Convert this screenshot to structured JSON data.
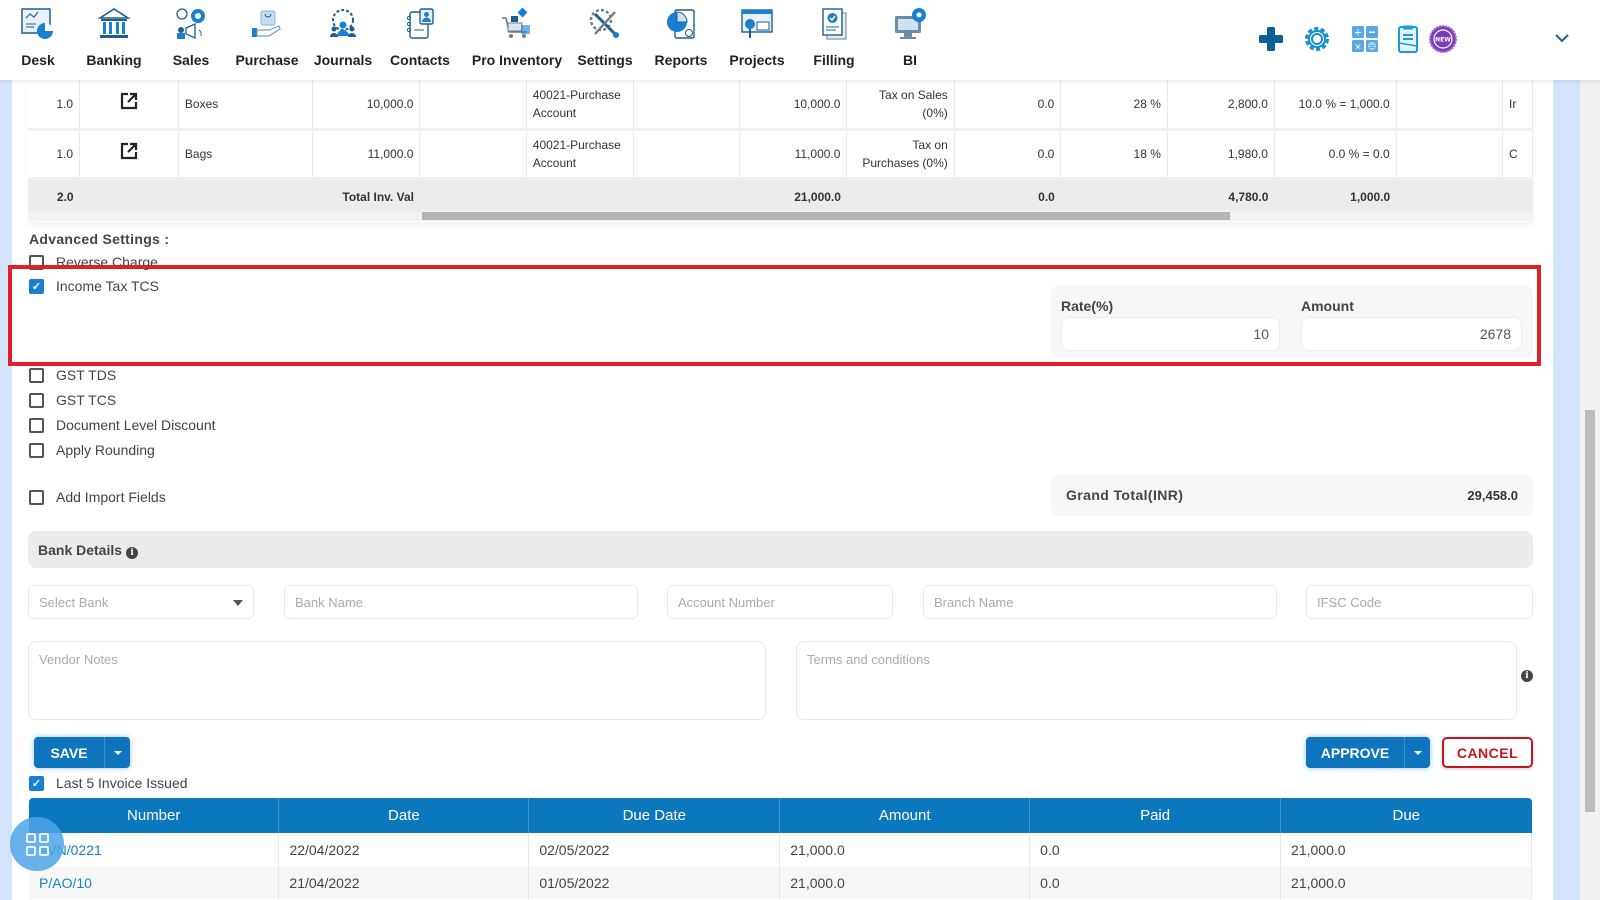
{
  "nav": {
    "items": [
      {
        "label": "Desk",
        "icon": "desk-dashboard-icon"
      },
      {
        "label": "Banking",
        "icon": "bank-building-icon"
      },
      {
        "label": "Sales",
        "icon": "sales-megaphone-icon"
      },
      {
        "label": "Purchase",
        "icon": "purchase-bag-hand-icon"
      },
      {
        "label": "Journals",
        "icon": "journals-team-gear-icon"
      },
      {
        "label": "Contacts",
        "icon": "contacts-book-icon"
      },
      {
        "label": "Pro Inventory",
        "icon": "inventory-cart-icon"
      },
      {
        "label": "Settings",
        "icon": "settings-tools-icon"
      },
      {
        "label": "Reports",
        "icon": "reports-pie-chart-icon"
      },
      {
        "label": "Projects",
        "icon": "projects-board-icon"
      },
      {
        "label": "Filling",
        "icon": "filling-document-check-icon"
      },
      {
        "label": "BI",
        "icon": "bi-monitor-gear-icon"
      }
    ],
    "tools": [
      "plus-icon",
      "gear-icon",
      "calculator-icon",
      "clipboard-icon",
      "new-badge-icon",
      "chevron-down-icon"
    ],
    "new_badge_text": "NEW"
  },
  "items_table": {
    "rows": [
      {
        "qty": "1.0",
        "item": "Boxes",
        "rate": "10,000.0",
        "account": "40021-Purchase Account",
        "amount": "10,000.0",
        "tax": "Tax on Sales (0%)",
        "tax_amt": "0.0",
        "gst": "28 %",
        "gst_amt": "2,800.0",
        "tcs": "10.0 % = 1,000.0",
        "extra": "Ir"
      },
      {
        "qty": "1.0",
        "item": "Bags",
        "rate": "11,000.0",
        "account": "40021-Purchase Account",
        "amount": "11,000.0",
        "tax": "Tax on Purchases (0%)",
        "tax_amt": "0.0",
        "gst": "18 %",
        "gst_amt": "1,980.0",
        "tcs": "0.0 % = 0.0",
        "extra": "C"
      }
    ],
    "total": {
      "qty": "2.0",
      "label": "Total Inv. Val",
      "amount": "21,000.0",
      "tax_amt": "0.0",
      "gst_amt": "4,780.0",
      "tcs": "1,000.0"
    }
  },
  "advanced": {
    "title": "Advanced Settings :",
    "options": [
      {
        "label": "Reverse Charge",
        "checked": false
      },
      {
        "label": "Income Tax TCS",
        "checked": true
      },
      {
        "label": "GST TDS",
        "checked": false
      },
      {
        "label": "GST TCS",
        "checked": false
      },
      {
        "label": "Document Level Discount",
        "checked": false
      },
      {
        "label": "Apply Rounding",
        "checked": false
      },
      {
        "label": "Add Import Fields",
        "checked": false
      }
    ],
    "tcs": {
      "rate_label": "Rate(%)",
      "rate_value": "10",
      "amount_label": "Amount",
      "amount_value": "2678"
    },
    "highlight_color": "#e11f2b"
  },
  "grand_total": {
    "label": "Grand Total(INR)",
    "value": "29,458.0"
  },
  "bank": {
    "title": "Bank Details",
    "select_placeholder": "Select Bank",
    "bank_name_placeholder": "Bank Name",
    "account_number_placeholder": "Account Number",
    "branch_name_placeholder": "Branch Name",
    "ifsc_placeholder": "IFSC Code"
  },
  "notes": {
    "vendor_placeholder": "Vendor Notes",
    "terms_placeholder": "Terms and conditions"
  },
  "actions": {
    "save": "SAVE",
    "approve": "APPROVE",
    "cancel": "CANCEL",
    "primary_color": "#0e74bd",
    "cancel_color": "#c9141d"
  },
  "last_invoices": {
    "label": "Last 5 Invoice Issued",
    "checked": true,
    "columns": [
      "Number",
      "Date",
      "Due Date",
      "Amount",
      "Paid",
      "Due"
    ],
    "rows": [
      {
        "number": "AVN/0221",
        "date": "22/04/2022",
        "due_date": "02/05/2022",
        "amount": "21,000.0",
        "paid": "0.0",
        "due": "21,000.0"
      },
      {
        "number": "P/AO/10",
        "date": "21/04/2022",
        "due_date": "01/05/2022",
        "amount": "21,000.0",
        "paid": "0.0",
        "due": "21,000.0"
      }
    ]
  }
}
